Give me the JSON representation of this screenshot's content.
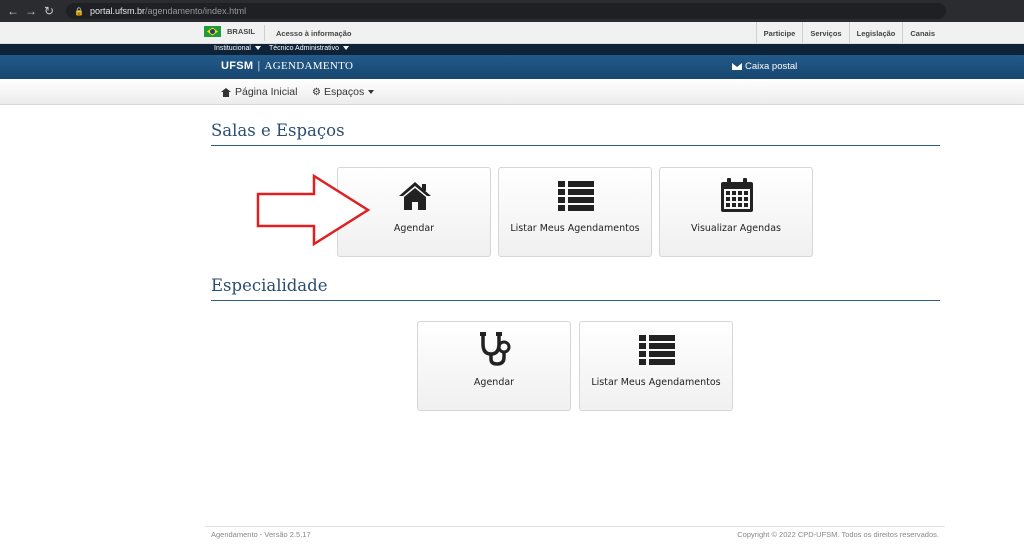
{
  "browser": {
    "url_host": "portal.ufsm.br",
    "url_path": "/agendamento/index.html"
  },
  "govbar": {
    "brasil": "BRASIL",
    "acesso": "Acesso à informação",
    "links": [
      "Participe",
      "Serviços",
      "Legislação",
      "Canais"
    ]
  },
  "instbar": {
    "institucional": "Institucional",
    "tecnico": "Técnico Administrativo"
  },
  "header": {
    "brand": "UFSM",
    "app_name": "AGENDAMENTO",
    "mail": "Caixa postal"
  },
  "nav": {
    "home": "Página Inicial",
    "espacos": "Espaços"
  },
  "sections": {
    "salas": {
      "title": "Salas e Espaços",
      "tiles": [
        "Agendar",
        "Listar Meus Agendamentos",
        "Visualizar Agendas"
      ]
    },
    "especialidade": {
      "title": "Especialidade",
      "tiles": [
        "Agendar",
        "Listar Meus Agendamentos"
      ]
    }
  },
  "footer": {
    "version": "Agendamento - Versão 2.5.17",
    "copyright": "Copyright © 2022 CPD-UFSM. Todos os direitos reservados."
  },
  "colors": {
    "header_blue": "#1e4f7c",
    "title_blue": "#2c4e6e",
    "arrow_red": "#e02020"
  },
  "icons": {
    "salas_tiles": [
      "home-icon",
      "list-icon",
      "calendar-icon"
    ],
    "especialidade_tiles": [
      "stethoscope-icon",
      "list-icon"
    ]
  }
}
